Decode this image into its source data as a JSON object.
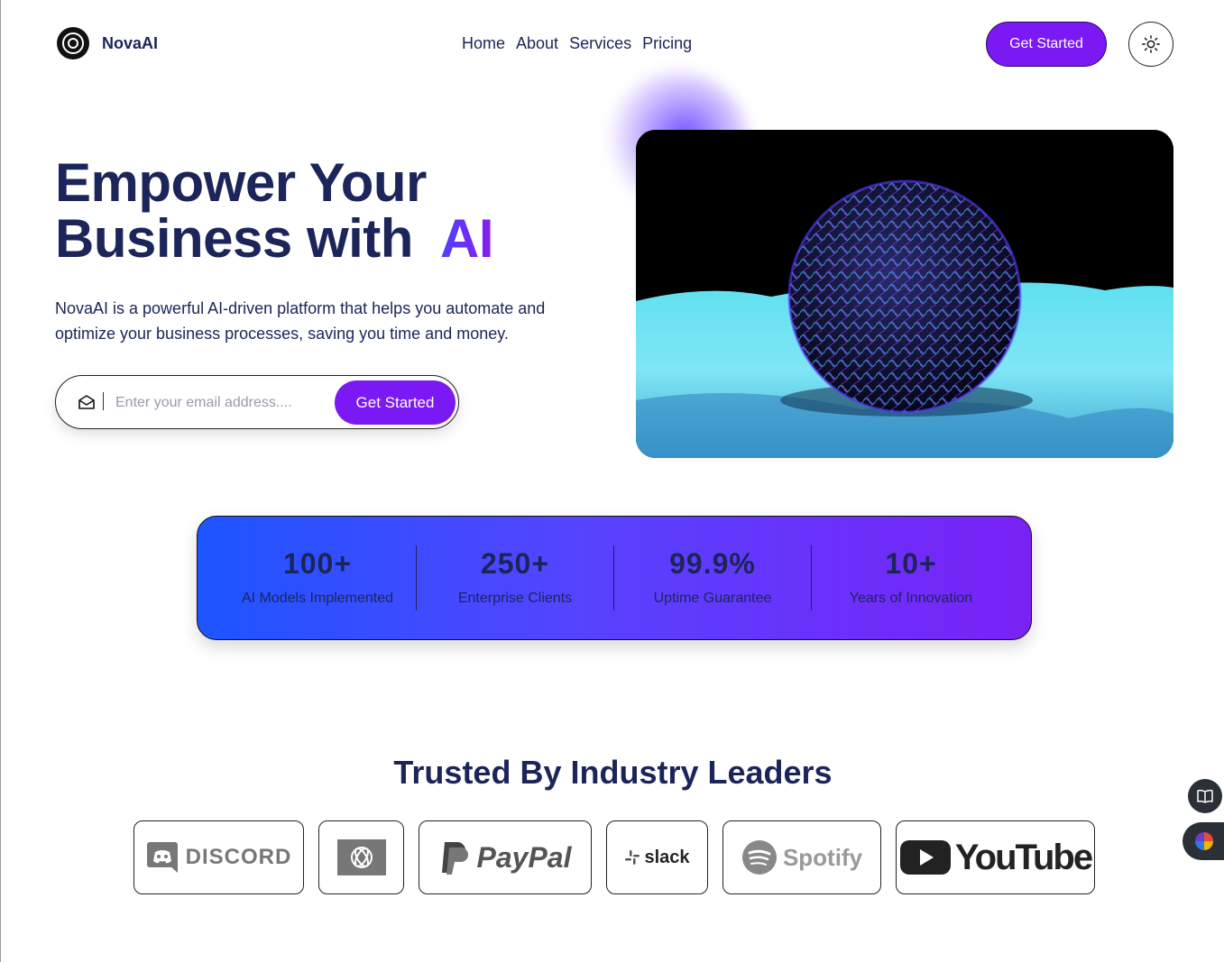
{
  "nav": {
    "brand": "NovaAI",
    "links": [
      "Home",
      "About",
      "Services",
      "Pricing"
    ],
    "cta": "Get Started"
  },
  "hero": {
    "title_line1": "Empower Your",
    "title_line2_prefix": "Business with",
    "title_highlight": "AI",
    "description": "NovaAI is a powerful AI-driven platform that helps you automate and optimize your business processes, saving you time and money.",
    "email_placeholder": "Enter your email address....",
    "email_button": "Get Started"
  },
  "stats": [
    {
      "value": "100+",
      "label": "AI Models Implemented"
    },
    {
      "value": "250+",
      "label": "Enterprise Clients"
    },
    {
      "value": "99.9%",
      "label": "Uptime Guarantee"
    },
    {
      "value": "10+",
      "label": "Years of Innovation"
    }
  ],
  "trusted": {
    "heading": "Trusted By Industry Leaders",
    "logos": [
      "DISCORD",
      "PayPal",
      "slack",
      "Spotify",
      "YouTube"
    ]
  },
  "colors": {
    "accent": "#7a19f3",
    "navy": "#1b2559",
    "gradient_start": "#1d55ff",
    "gradient_end": "#7a22f5"
  },
  "icons": [
    "logo-icon",
    "sun-icon",
    "mail-icon",
    "book-icon",
    "color-wheel-icon"
  ]
}
